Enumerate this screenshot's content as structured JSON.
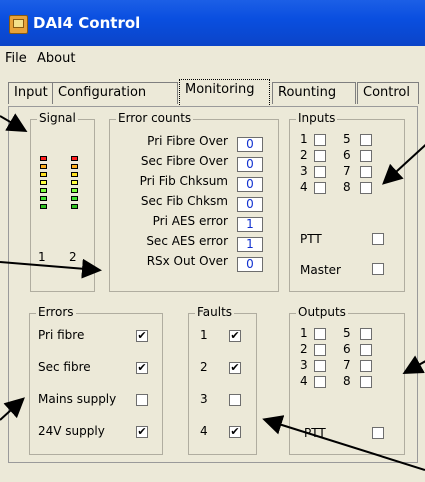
{
  "window": {
    "title": "DAI4 Control"
  },
  "menu": [
    "File",
    "About"
  ],
  "tabs": [
    "Input",
    "Configuration",
    "Monitoring",
    "Rounting",
    "Control"
  ],
  "signal": {
    "title": "Signal",
    "channels": [
      {
        "label": "1",
        "segments": [
          "#ff2020",
          "#ffb020",
          "#ffe020",
          "#ffff40",
          "#80ff40",
          "#40e030",
          "#30c020"
        ]
      },
      {
        "label": "2",
        "segments": [
          "#ff2020",
          "#ffb020",
          "#ffe020",
          "#ffff40",
          "#80ff40",
          "#40e030",
          "#30c020"
        ]
      }
    ]
  },
  "error_counts": {
    "title": "Error counts",
    "rows": [
      {
        "label": "Pri Fibre Over",
        "value": "0"
      },
      {
        "label": "Sec Fibre Over",
        "value": "0"
      },
      {
        "label": "Pri Fib Chksum",
        "value": "0"
      },
      {
        "label": "Sec Fib Chksm",
        "value": "0"
      },
      {
        "label": "Pri AES error",
        "value": "1"
      },
      {
        "label": "Sec AES error",
        "value": "1"
      },
      {
        "label": "RSx Out Over",
        "value": "0"
      }
    ]
  },
  "inputs": {
    "title": "Inputs",
    "rows": [
      {
        "a": "1",
        "b": "5"
      },
      {
        "a": "2",
        "b": "6"
      },
      {
        "a": "3",
        "b": "7"
      },
      {
        "a": "4",
        "b": "8"
      }
    ],
    "ptt": "PTT",
    "master": "Master"
  },
  "errors": {
    "title": "Errors",
    "rows": [
      {
        "label": "Pri fibre",
        "checked": true
      },
      {
        "label": "Sec fibre",
        "checked": true
      },
      {
        "label": "Mains supply",
        "checked": false
      },
      {
        "label": "24V supply",
        "checked": true
      }
    ]
  },
  "faults": {
    "title": "Faults",
    "rows": [
      {
        "label": "1",
        "checked": true
      },
      {
        "label": "2",
        "checked": true
      },
      {
        "label": "3",
        "checked": false
      },
      {
        "label": "4",
        "checked": true
      }
    ]
  },
  "outputs": {
    "title": "Outputs",
    "rows": [
      {
        "a": "1",
        "b": "5"
      },
      {
        "a": "2",
        "b": "6"
      },
      {
        "a": "3",
        "b": "7"
      },
      {
        "a": "4",
        "b": "8"
      }
    ],
    "ptt": "PTT"
  },
  "check_mark": "✔"
}
